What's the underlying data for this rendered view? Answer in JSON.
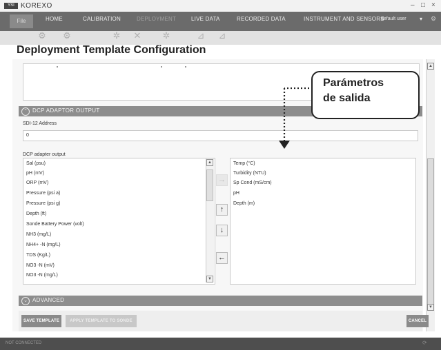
{
  "window": {
    "logo": "YSI",
    "title": "KOREXO",
    "controls": [
      "–",
      "□",
      "×"
    ]
  },
  "menu": {
    "file": "File",
    "items": [
      {
        "label": "HOME",
        "enabled": true
      },
      {
        "label": "CALIBRATION",
        "enabled": true
      },
      {
        "label": "DEPLOYMENT",
        "enabled": false
      },
      {
        "label": "LIVE DATA",
        "enabled": true
      },
      {
        "label": "RECORDED DATA",
        "enabled": true
      },
      {
        "label": "INSTRUMENT AND SENSORS",
        "enabled": true
      }
    ],
    "user": "default user",
    "user_arrow": "▾",
    "settings_icon": "⚙"
  },
  "ribbon_icons": [
    "gear-icon",
    "gear-icon",
    "settings-icon",
    "wrench-icon",
    "settings-icon",
    "chart-icon",
    "chart-icon"
  ],
  "page": {
    "title": "Deployment Template Configuration"
  },
  "sections": {
    "dcp": {
      "label": "DCP ADAPTOR OUTPUT",
      "icon": "⌃"
    },
    "advanced": {
      "label": "ADVANCED",
      "icon": "⌄"
    }
  },
  "sdi": {
    "label": "SDI-12 Address",
    "value": "0"
  },
  "dcp_output_label": "DCP adapter output",
  "available_params": [
    "Sal (psu)",
    "pH (mV)",
    "ORP (mV)",
    "Pressure (psi a)",
    "Pressure (psi g)",
    "Depth (ft)",
    "Sonde Battery Power (volt)",
    "NH3 (mg/L)",
    "NH4+ -N (mg/L)",
    "TDS (Kg/L)",
    "NO3 -N (mV)",
    "NO3 -N (mg/L)"
  ],
  "selected_params": [
    "Temp (°C)",
    "Turbidity (NTU)",
    "Sp Cond (mS/cm)",
    "pH",
    "Depth (m)"
  ],
  "move_buttons": {
    "add": "→",
    "up": "↑",
    "down": "↓",
    "remove": "←"
  },
  "buttons": {
    "save": "SAVE TEMPLATE",
    "apply": "APPLY TEMPLATE TO SONDE",
    "cancel": "CANCEL"
  },
  "status": {
    "text": "NOT CONNECTED",
    "right": "⟳"
  },
  "callout": {
    "line1": "Parámetros",
    "line2": "de salida"
  }
}
